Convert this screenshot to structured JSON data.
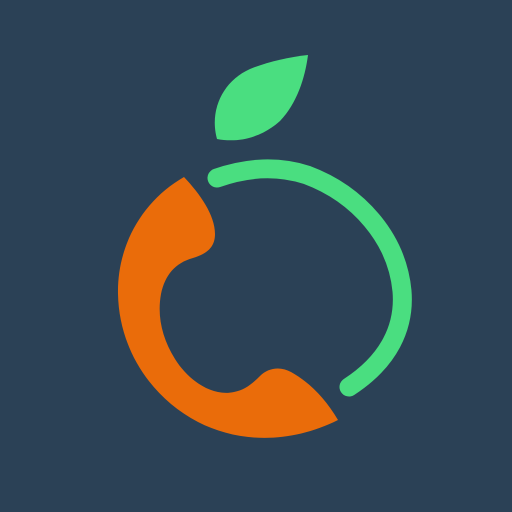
{
  "app_icon": {
    "icon": "orange-phone-logo-icon",
    "parts": {
      "leaf": "leaf-icon",
      "ring": "ring-arc-icon",
      "handset": "phone-handset-icon"
    },
    "colors": {
      "background": "#2b4156",
      "leaf": "#4ade80",
      "ring": "#4ade80",
      "handset": "#ea6c0a"
    }
  }
}
